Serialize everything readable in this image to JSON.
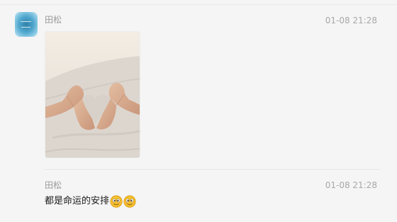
{
  "messages": [
    {
      "sender": "田松",
      "time": "01-08 21:28",
      "content_type": "image",
      "image_icon": "heart-hands-photo"
    },
    {
      "sender": "田松",
      "time": "01-08 21:28",
      "content_type": "text",
      "text": "都是命运的安排",
      "emojis": [
        "cheeky-smile-emoji",
        "cheeky-smile-emoji"
      ]
    }
  ],
  "colors": {
    "background": "#f5f5f5",
    "sender_text": "#999999",
    "time_text": "#a8a8a8",
    "message_text": "#1a1a1a",
    "avatar": "#4fa6cc",
    "emoji_face": "#f6c12e"
  }
}
